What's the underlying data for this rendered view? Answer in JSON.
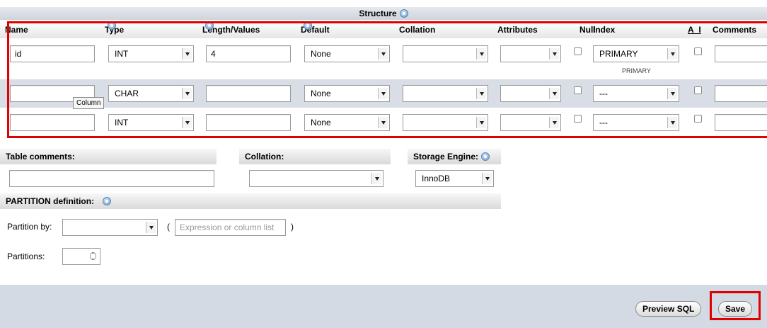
{
  "structure": {
    "title": "Structure",
    "headers": {
      "name": "Name",
      "type": "Type",
      "length": "Length/Values",
      "default": "Default",
      "collation": "Collation",
      "attributes": "Attributes",
      "null": "Null",
      "index": "Index",
      "ai": "A_I",
      "comments": "Comments"
    },
    "rows": [
      {
        "name": "id",
        "type": "INT",
        "length": "4",
        "default": "None",
        "collation": "",
        "attributes": "",
        "index": "PRIMARY",
        "index_note": "PRIMARY"
      },
      {
        "name": "",
        "type": "CHAR",
        "length": "",
        "default": "None",
        "collation": "",
        "attributes": "",
        "index": "---",
        "index_note": ""
      },
      {
        "name": "",
        "type": "INT",
        "length": "",
        "default": "None",
        "collation": "",
        "attributes": "",
        "index": "---",
        "index_note": ""
      }
    ],
    "tooltip": "Column"
  },
  "table_options": {
    "comments_label": "Table comments:",
    "collation_label": "Collation:",
    "collation_value": "",
    "engine_label": "Storage Engine:",
    "engine_value": "InnoDB"
  },
  "partition": {
    "header": "PARTITION definition:",
    "by_label": "Partition by:",
    "by_value": "",
    "paren_open": "(",
    "expression_placeholder": "Expression or column list",
    "paren_close": ")",
    "partitions_label": "Partitions:",
    "partitions_value": ""
  },
  "footer": {
    "preview_sql": "Preview SQL",
    "save": "Save"
  },
  "colors": {
    "highlight": "#e00000",
    "row_alt": "#d8dde6",
    "footer_bg": "#d3dae4"
  }
}
